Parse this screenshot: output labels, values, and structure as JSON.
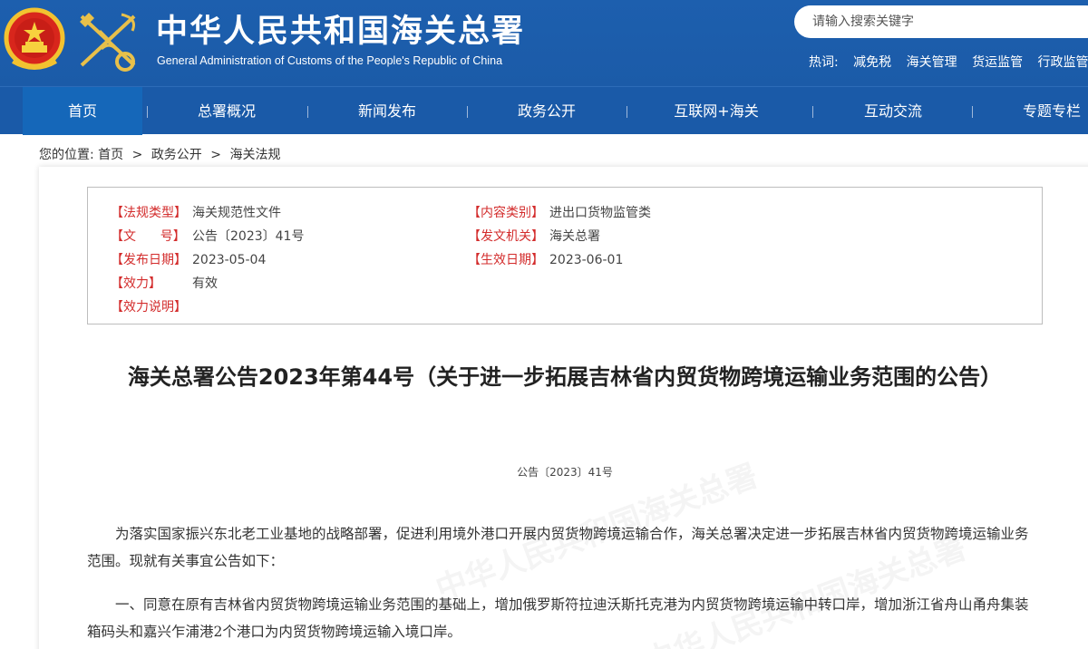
{
  "header": {
    "title": "中华人民共和国海关总署",
    "subtitle": "General Administration of Customs of the People's Republic of China",
    "search_placeholder": "请输入搜索关键字",
    "hot_label": "热词:",
    "hot_words": [
      "减免税",
      "海关管理",
      "货运监管",
      "行政监管"
    ]
  },
  "nav": {
    "items": [
      "首页",
      "总署概况",
      "新闻发布",
      "政务公开",
      "互联网+海关",
      "互动交流",
      "专题专栏"
    ],
    "separator": "|",
    "active_index": 0
  },
  "breadcrumb": {
    "prefix": "您的位置:",
    "items": [
      "首页",
      "政务公开",
      "海关法规"
    ],
    "separator": ">"
  },
  "meta": {
    "law_type_label": "【法规类型】",
    "law_type_value": "海关规范性文件",
    "content_type_label": "【内容类别】",
    "content_type_value": "进出口货物监管类",
    "doc_no_label": "【文      号】",
    "doc_no_value": "公告〔2023〕41号",
    "issuer_label": "【发文机关】",
    "issuer_value": "海关总署",
    "publish_date_label": "【发布日期】",
    "publish_date_value": "2023-05-04",
    "effective_date_label": "【生效日期】",
    "effective_date_value": "2023-06-01",
    "validity_label": "【效力】",
    "validity_value": "有效",
    "validity_note_label": "【效力说明】"
  },
  "document": {
    "title": "海关总署公告2023年第44号（关于进一步拓展吉林省内贸货物跨境运输业务范围的公告）",
    "number": "公告〔2023〕41号",
    "paragraphs": [
      "为落实国家振兴东北老工业基地的战略部署，促进利用境外港口开展内贸货物跨境运输合作，海关总署决定进一步拓展吉林省内贸货物跨境运输业务范围。现就有关事宜公告如下：",
      "一、同意在原有吉林省内贸货物跨境运输业务范围的基础上，增加俄罗斯符拉迪沃斯托克港为内贸货物跨境运输中转口岸，增加浙江省舟山甬舟集装箱码头和嘉兴乍浦港2个港口为内贸货物跨境运输入境口岸。"
    ]
  },
  "colors": {
    "header_blue": "#1b5ba8",
    "nav_active": "#1567b9",
    "meta_label_red": "#d32c2c"
  },
  "icons": {
    "emblem": "national-emblem-icon",
    "logo": "customs-logo-icon"
  }
}
